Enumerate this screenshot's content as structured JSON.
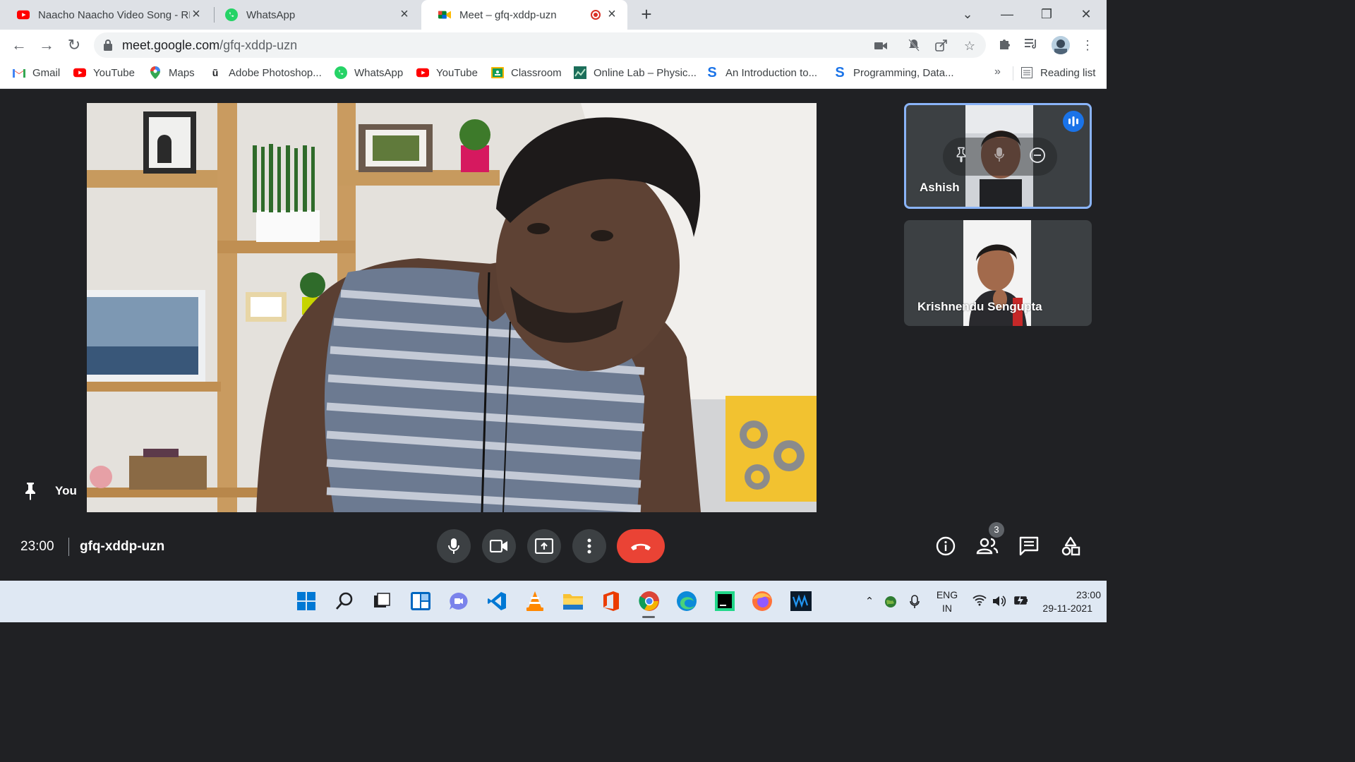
{
  "tabs": [
    {
      "title": "Naacho Naacho Video Song - RR",
      "icon": "youtube-icon"
    },
    {
      "title": "WhatsApp",
      "icon": "whatsapp-icon"
    },
    {
      "title": "Meet – gfq-xddp-uzn",
      "icon": "meet-icon",
      "active": true,
      "recording": true
    }
  ],
  "address": {
    "host": "meet.google.com",
    "path": "/gfq-xddp-uzn"
  },
  "bookmarks": [
    {
      "label": "Gmail",
      "icon": "gmail-icon"
    },
    {
      "label": "YouTube",
      "icon": "youtube-icon"
    },
    {
      "label": "Maps",
      "icon": "maps-icon"
    },
    {
      "label": "Adobe Photoshop...",
      "icon": "photoshop-icon"
    },
    {
      "label": "WhatsApp",
      "icon": "whatsapp-icon"
    },
    {
      "label": "YouTube",
      "icon": "youtube-icon"
    },
    {
      "label": "Classroom",
      "icon": "classroom-icon"
    },
    {
      "label": "Online Lab – Physic...",
      "icon": "lab-icon"
    },
    {
      "label": "An Introduction to...",
      "icon": "scribd-icon"
    },
    {
      "label": "Programming, Data...",
      "icon": "scribd-icon"
    }
  ],
  "reading_list": "Reading list",
  "bookmarks_more": "»",
  "meet": {
    "self_label": "You",
    "participants": [
      {
        "name": "Ashish",
        "speaking": true
      },
      {
        "name": "Krishnendu Sengupta",
        "speaking": false
      }
    ],
    "time": "23:00",
    "meeting_code": "gfq-xddp-uzn",
    "people_count": "3"
  },
  "taskbar": {
    "language": "ENG",
    "region": "IN",
    "clock_time": "23:00",
    "clock_date": "29-11-2021"
  },
  "colors": {
    "accent_blue": "#1a73e8",
    "end_call_red": "#ea4335",
    "meet_bg": "#202124",
    "tile_bg": "#3c4043"
  }
}
